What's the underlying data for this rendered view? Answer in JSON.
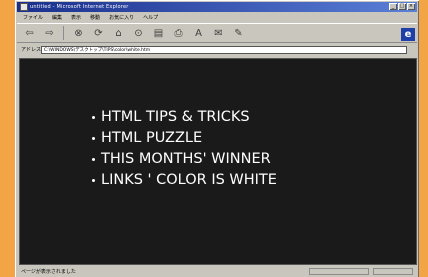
{
  "window": {
    "title": "untitled - Microsoft Internet Explorer"
  },
  "menu": [
    "ファイル",
    "編集",
    "表示",
    "移動",
    "お気に入り",
    "ヘルプ"
  ],
  "toolbar": {
    "buttons": [
      {
        "icon": "back-icon",
        "glyph": "⇦"
      },
      {
        "icon": "forward-icon",
        "glyph": "⇨"
      },
      {
        "icon": "stop-icon",
        "glyph": "⊗"
      },
      {
        "icon": "refresh-icon",
        "glyph": "⟳"
      },
      {
        "icon": "home-icon",
        "glyph": "⌂"
      },
      {
        "icon": "search-icon",
        "glyph": "⊙"
      },
      {
        "icon": "favorites-icon",
        "glyph": "▤"
      },
      {
        "icon": "print-icon",
        "glyph": "⎙"
      },
      {
        "icon": "font-icon",
        "glyph": "A"
      },
      {
        "icon": "mail-icon",
        "glyph": "✉"
      },
      {
        "icon": "edit-icon",
        "glyph": "✎"
      }
    ]
  },
  "address": {
    "label": "アドレス",
    "value": "C:\\WINDOWS\\デスクトップ\\TIPS\\color\\white.htm"
  },
  "content": {
    "tips": [
      "HTML TIPS & TRICKS",
      "HTML PUZZLE",
      "THIS MONTHS' WINNER",
      "LINKS ' COLOR IS WHITE"
    ]
  },
  "status": {
    "text": "ページが表示されました"
  },
  "colors": {
    "page_background": "#1a1a1a",
    "text": "#ffffff",
    "outer_background": "#f3a546"
  }
}
